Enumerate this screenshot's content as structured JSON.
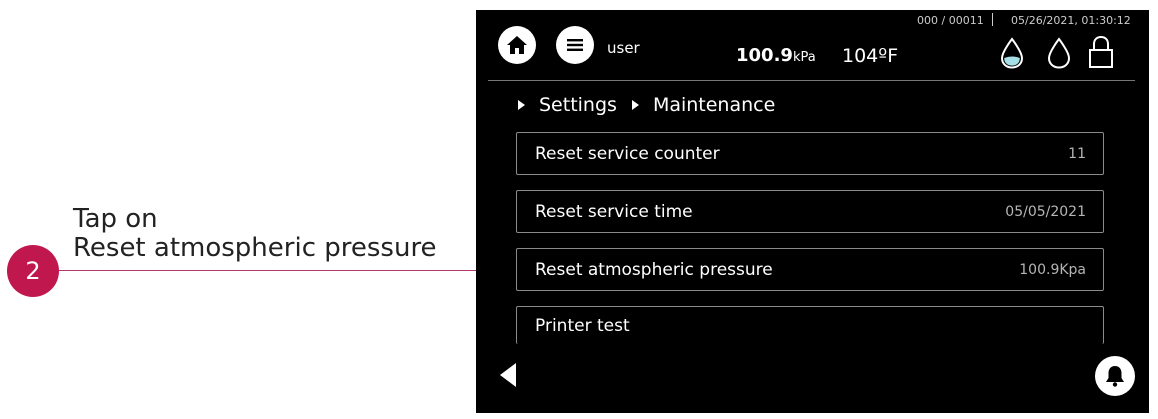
{
  "annotation": {
    "step_number": "2",
    "line1": "Tap on",
    "line2": "Reset atmospheric pressure"
  },
  "status": {
    "counter": "000 / 00011",
    "datetime": "05/26/2021, 01:30:12"
  },
  "header": {
    "user": "user",
    "pressure_value": "100.9",
    "pressure_unit": "kPa",
    "temperature": "104ºF"
  },
  "breadcrumb": [
    "Settings",
    "Maintenance"
  ],
  "items": [
    {
      "label": "Reset service counter",
      "value": "11"
    },
    {
      "label": "Reset service time",
      "value": "05/05/2021"
    },
    {
      "label": "Reset atmospheric pressure",
      "value": "100.9Kpa"
    },
    {
      "label": "Printer test",
      "value": ""
    }
  ],
  "icons": {
    "home": "home-icon",
    "menu": "menu-icon",
    "water_filled": "water-drop-filled-icon",
    "water_empty": "water-drop-outline-icon",
    "lock": "lock-icon",
    "back": "back-arrow-icon",
    "bell": "bell-icon"
  },
  "colors": {
    "accent": "#c0174f",
    "screen_bg": "#000000",
    "drop_fill": "#a7dfe6"
  }
}
